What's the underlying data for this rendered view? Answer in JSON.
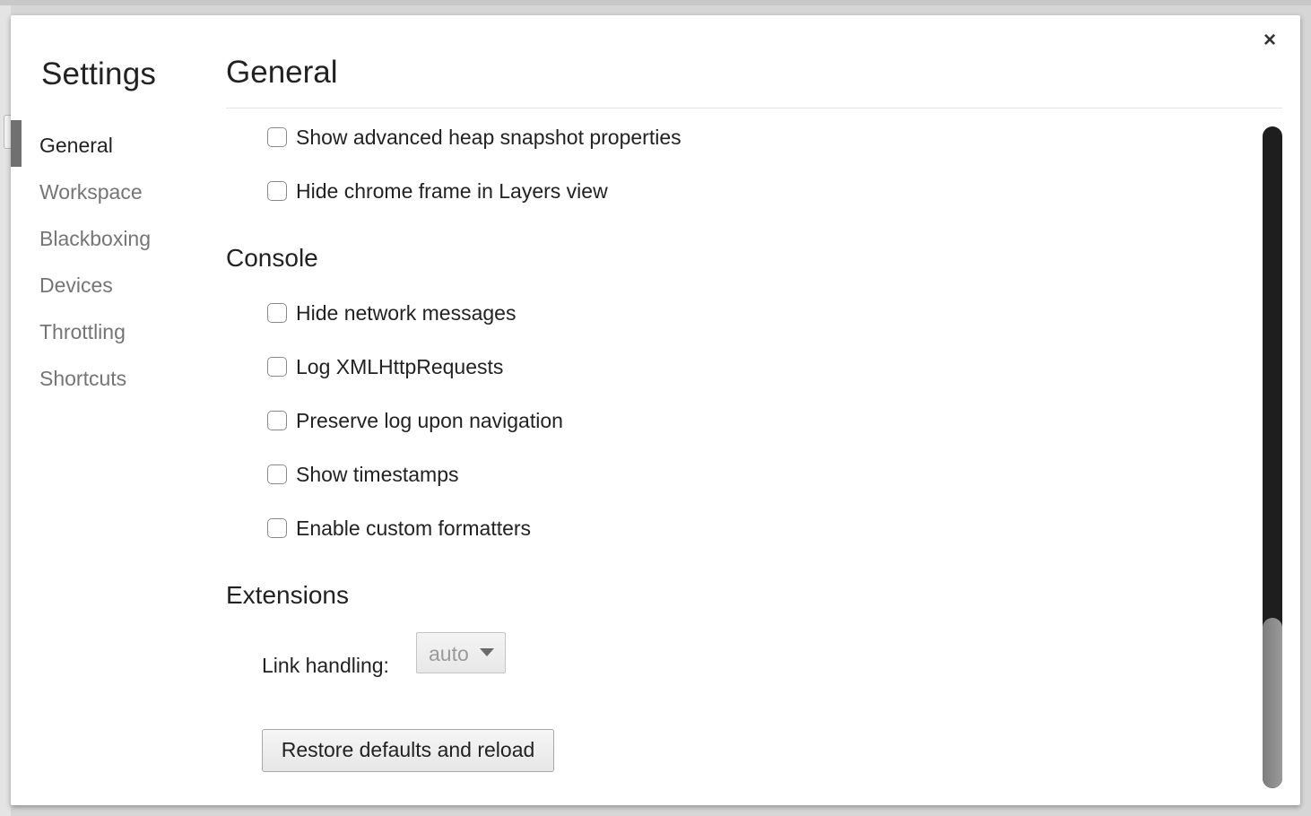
{
  "window": {
    "close_glyph": "×"
  },
  "sidebar": {
    "title": "Settings",
    "items": [
      {
        "label": "General",
        "selected": true
      },
      {
        "label": "Workspace",
        "selected": false
      },
      {
        "label": "Blackboxing",
        "selected": false
      },
      {
        "label": "Devices",
        "selected": false
      },
      {
        "label": "Throttling",
        "selected": false
      },
      {
        "label": "Shortcuts",
        "selected": false
      }
    ]
  },
  "main": {
    "title": "General",
    "top_options": [
      {
        "label": "Show advanced heap snapshot properties",
        "checked": false
      },
      {
        "label": "Hide chrome frame in Layers view",
        "checked": false
      }
    ],
    "console": {
      "title": "Console",
      "options": [
        {
          "label": "Hide network messages",
          "checked": false
        },
        {
          "label": "Log XMLHttpRequests",
          "checked": false
        },
        {
          "label": "Preserve log upon navigation",
          "checked": false
        },
        {
          "label": "Show timestamps",
          "checked": false
        },
        {
          "label": "Enable custom formatters",
          "checked": false
        }
      ]
    },
    "extensions": {
      "title": "Extensions",
      "link_handling_label": "Link handling:",
      "link_handling_value": "auto"
    },
    "restore_button": "Restore defaults and reload"
  },
  "colors": {
    "selected_indicator": "#707070",
    "scrollbar_track": "#1e1e1e",
    "scrollbar_thumb": "#8a8a8a"
  }
}
